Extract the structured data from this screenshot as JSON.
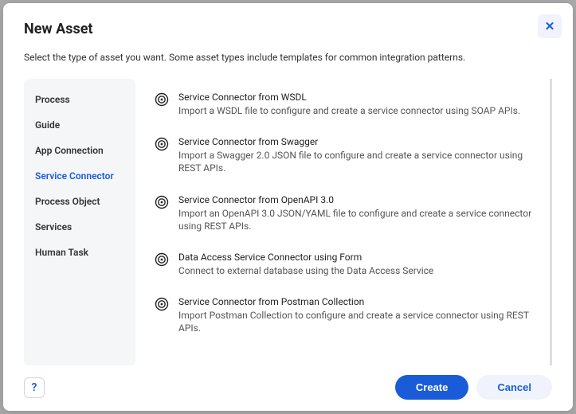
{
  "dialog": {
    "title": "New Asset",
    "subtitle": "Select the type of asset you want. Some asset types include templates for common integration patterns.",
    "close_label": "✕"
  },
  "sidebar": {
    "items": [
      {
        "label": "Process",
        "selected": false
      },
      {
        "label": "Guide",
        "selected": false
      },
      {
        "label": "App Connection",
        "selected": false
      },
      {
        "label": "Service Connector",
        "selected": true
      },
      {
        "label": "Process Object",
        "selected": false
      },
      {
        "label": "Services",
        "selected": false
      },
      {
        "label": "Human Task",
        "selected": false
      }
    ]
  },
  "options": [
    {
      "title": "Service Connector from WSDL",
      "desc": "Import a WSDL file to configure and create a service connector using SOAP APIs."
    },
    {
      "title": "Service Connector from Swagger",
      "desc": "Import a Swagger 2.0 JSON file to configure and create a service connector using REST APIs."
    },
    {
      "title": "Service Connector from OpenAPI 3.0",
      "desc": "Import an OpenAPI 3.0 JSON/YAML file to configure and create a service connector using REST APIs."
    },
    {
      "title": "Data Access Service Connector using Form",
      "desc": "Connect to external database using the Data Access Service"
    },
    {
      "title": "Service Connector from Postman Collection",
      "desc": "Import Postman Collection to configure and create a service connector using REST APIs."
    }
  ],
  "footer": {
    "help_label": "?",
    "create_label": "Create",
    "cancel_label": "Cancel"
  }
}
